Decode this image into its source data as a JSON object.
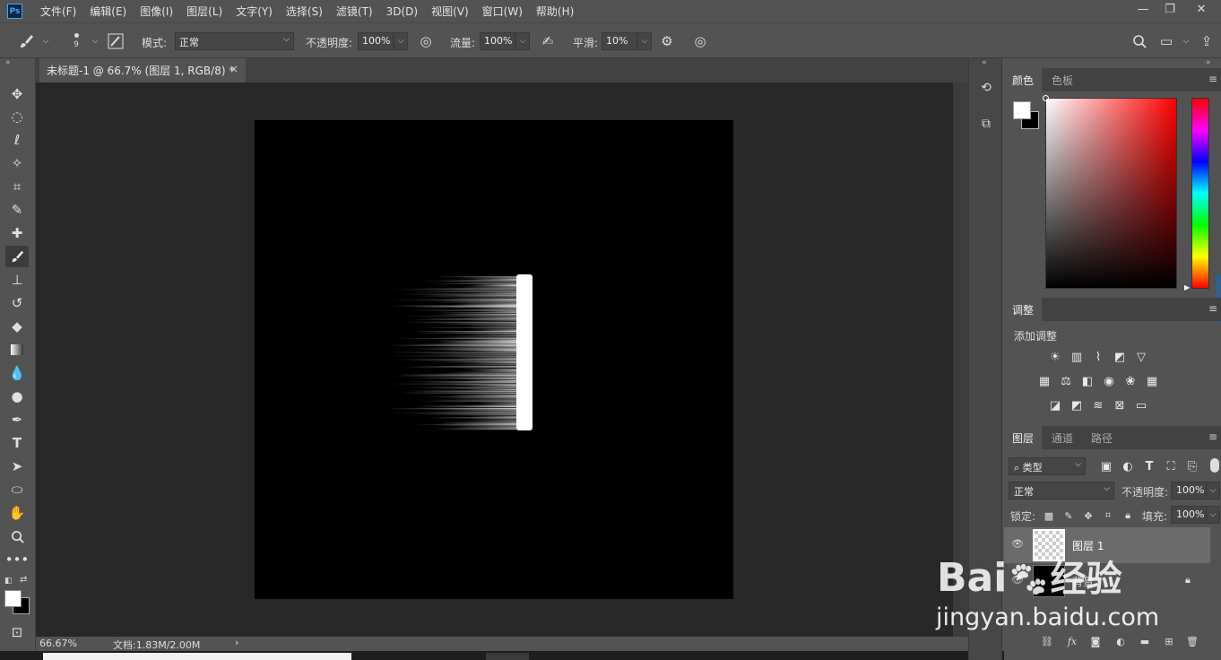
{
  "app": {
    "logo": "Ps"
  },
  "menu": [
    "文件(F)",
    "编辑(E)",
    "图像(I)",
    "图层(L)",
    "文字(Y)",
    "选择(S)",
    "滤镜(T)",
    "3D(D)",
    "视图(V)",
    "窗口(W)",
    "帮助(H)"
  ],
  "window_controls": {
    "minimize": "—",
    "restore": "❐",
    "close": "✕"
  },
  "options": {
    "brush_size": "9",
    "mode_label": "模式:",
    "mode_value": "正常",
    "opacity_label": "不透明度:",
    "opacity_value": "100%",
    "flow_label": "流量:",
    "flow_value": "100%",
    "smooth_label": "平滑:",
    "smooth_value": "10%"
  },
  "document": {
    "tab_title": "未标题-1 @ 66.7% (图层 1, RGB/8) *",
    "tab_close": "×"
  },
  "status": {
    "zoom": "66.67%",
    "doc_size": "文档:1.83M/2.00M",
    "arrow": "›"
  },
  "panels": {
    "color_tabs": [
      "颜色",
      "色板"
    ],
    "adjust_tab": "调整",
    "adjust_title": "添加调整",
    "layers_tabs": [
      "图层",
      "通道",
      "路径"
    ],
    "filter_kind": "类型",
    "blend_mode": "正常",
    "opacity_label": "不透明度:",
    "opacity_value": "100%",
    "lock_label": "锁定:",
    "fill_label": "填充:",
    "fill_value": "100%",
    "layers": [
      {
        "name": "图层 1",
        "selected": true
      },
      {
        "name": "背景",
        "locked": true
      }
    ]
  },
  "watermark": {
    "brand": "Bai",
    "cn": "经验",
    "url": "jingyan.baidu.com"
  },
  "colors": {
    "accent": "#31a8ff",
    "panel": "#535353",
    "canvas": "#000000",
    "workspace": "#282828"
  }
}
